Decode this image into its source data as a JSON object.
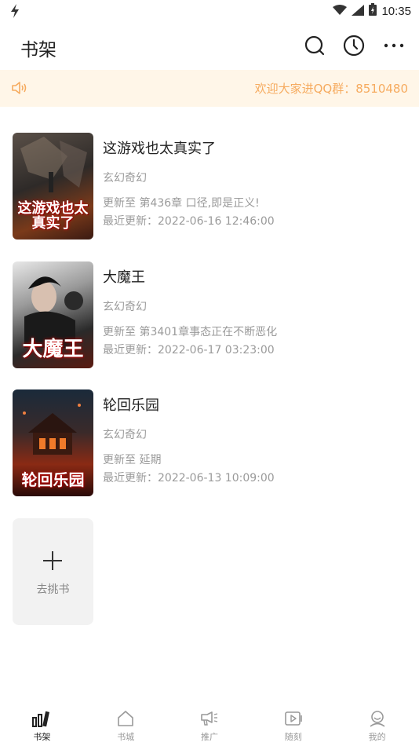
{
  "status_bar": {
    "time": "10:35"
  },
  "header": {
    "title": "书架"
  },
  "notice": {
    "text": "欢迎大家进QQ群：8510480"
  },
  "books": [
    {
      "title": "这游戏也太真实了",
      "genre": "玄幻奇幻",
      "chapter": "更新至 第436章 口径,即是正义!",
      "updated": "最近更新：2022-06-16 12:46:00",
      "cover_text": "这游戏也太真实了"
    },
    {
      "title": "大魔王",
      "genre": "玄幻奇幻",
      "chapter": "更新至 第3401章事态正在不断恶化",
      "updated": "最近更新：2022-06-17 03:23:00",
      "cover_text": "大魔王"
    },
    {
      "title": "轮回乐园",
      "genre": "玄幻奇幻",
      "chapter": "更新至 延期",
      "updated": "最近更新：2022-06-13 10:09:00",
      "cover_text": "轮回乐园"
    }
  ],
  "add_book": {
    "label": "去挑书"
  },
  "bottom_nav": [
    {
      "label": "书架",
      "icon": "bookshelf-icon",
      "active": true
    },
    {
      "label": "书城",
      "icon": "home-icon",
      "active": false
    },
    {
      "label": "推广",
      "icon": "megaphone-icon",
      "active": false
    },
    {
      "label": "随刻",
      "icon": "video-icon",
      "active": false
    },
    {
      "label": "我的",
      "icon": "profile-icon",
      "active": false
    }
  ],
  "colors": {
    "notice_bg": "#fff6e8",
    "notice_text": "#f6ab5f",
    "muted": "#9a9a9a"
  }
}
